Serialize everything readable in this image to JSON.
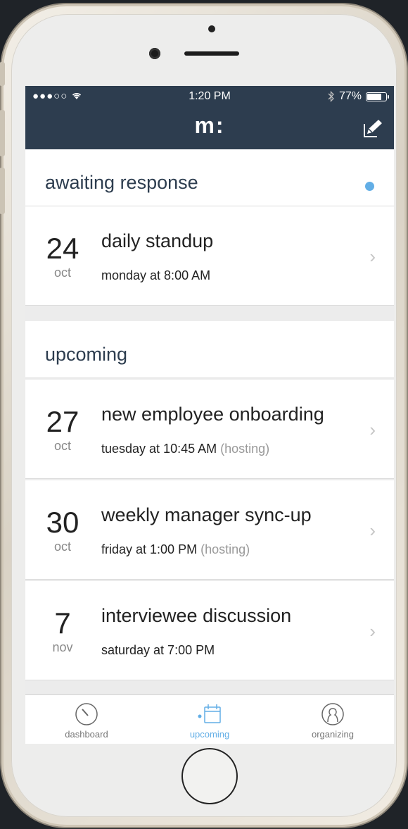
{
  "status_bar": {
    "signal": "●●●○○",
    "time": "1:20 PM",
    "battery": "77%",
    "battery_level": 0.77
  },
  "nav": {
    "logo": "m:",
    "compose_icon": "compose-icon"
  },
  "sections": {
    "awaiting": {
      "title": "awaiting response"
    },
    "upcoming": {
      "title": "upcoming"
    }
  },
  "events": [
    {
      "day": "24",
      "month": "oct",
      "title": "daily standup",
      "when": "monday at 8:00 AM",
      "host": ""
    },
    {
      "day": "27",
      "month": "oct",
      "title": "new employee onboarding",
      "when": "tuesday at 10:45 AM",
      "host": "(hosting)"
    },
    {
      "day": "30",
      "month": "oct",
      "title": "weekly manager sync-up",
      "when": "friday at 1:00 PM",
      "host": "(hosting)"
    },
    {
      "day": "7",
      "month": "nov",
      "title": "interviewee discussion",
      "when": "saturday at 7:00 PM",
      "host": ""
    }
  ],
  "tabs": [
    {
      "label": "dashboard",
      "icon": "dashboard-icon"
    },
    {
      "label": "upcoming",
      "icon": "calendar-icon"
    },
    {
      "label": "organizing",
      "icon": "person-icon"
    }
  ],
  "colors": {
    "nav_bg": "#2d3d4f",
    "accent": "#62aee6"
  }
}
